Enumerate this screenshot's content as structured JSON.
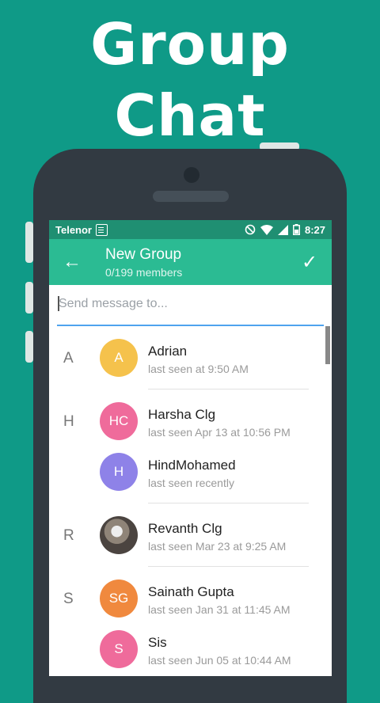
{
  "promo": {
    "line1": "Group",
    "line2": "Chat"
  },
  "status_bar": {
    "carrier": "Telenor",
    "time": "8:27"
  },
  "app_bar": {
    "title": "New Group",
    "subtitle": "0/199 members"
  },
  "search": {
    "placeholder": "Send message to..."
  },
  "contacts": [
    {
      "section": "A",
      "initials": "A",
      "name": "Adrian",
      "last_seen": "last seen at 9:50 AM",
      "color": "#f5c24c"
    },
    {
      "section": "H",
      "initials": "HC",
      "name": "Harsha Clg",
      "last_seen": "last seen Apr 13 at 10:56 PM",
      "color": "#ef6b9b"
    },
    {
      "section": "",
      "initials": "H",
      "name": "HindMohamed",
      "last_seen": "last seen recently",
      "color": "#8e82e8"
    },
    {
      "section": "R",
      "initials": "",
      "name": "Revanth Clg",
      "last_seen": "last seen Mar 23 at 9:25 AM",
      "color": "#6b625b"
    },
    {
      "section": "S",
      "initials": "SG",
      "name": "Sainath Gupta",
      "last_seen": "last seen Jan 31 at 11:45 AM",
      "color": "#f0893e"
    },
    {
      "section": "",
      "initials": "S",
      "name": "Sis",
      "last_seen": "last seen Jun 05 at 10:44 AM",
      "color": "#ef6b9b"
    }
  ]
}
